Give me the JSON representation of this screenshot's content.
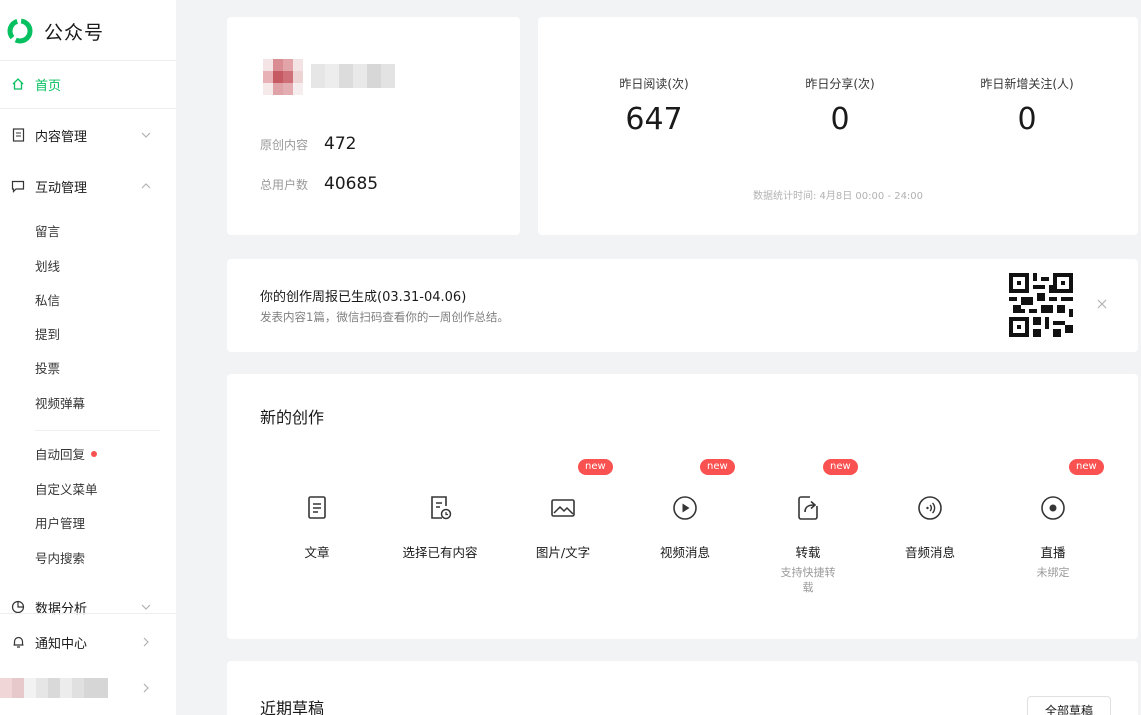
{
  "brand": {
    "name": "公众号",
    "accent": "#07c160"
  },
  "sidebar": {
    "home": "首页",
    "content_mgmt": "内容管理",
    "interaction_mgmt": "互动管理",
    "interaction_items": [
      "留言",
      "划线",
      "私信",
      "提到",
      "投票",
      "视频弹幕"
    ],
    "other_items": [
      "自动回复",
      "自定义菜单",
      "用户管理",
      "号内搜索"
    ],
    "data_analysis": "数据分析",
    "notifications": "通知中心"
  },
  "account": {
    "original_label": "原创内容",
    "original_value": "472",
    "users_label": "总用户数",
    "users_value": "40685"
  },
  "stats": {
    "reads_label": "昨日阅读(次)",
    "reads_value": "647",
    "shares_label": "昨日分享(次)",
    "shares_value": "0",
    "follows_label": "昨日新增关注(人)",
    "follows_value": "0",
    "note": "数据统计时间: 4月8日 00:00 - 24:00"
  },
  "report": {
    "title": "你的创作周报已生成(03.31-04.06)",
    "subtitle": "发表内容1篇，微信扫码查看你的一周创作总结。"
  },
  "create": {
    "title": "新的创作",
    "badge": "new",
    "items": [
      {
        "label": "文章",
        "icon": "article-icon"
      },
      {
        "label": "选择已有内容",
        "icon": "existing-content-icon"
      },
      {
        "label": "图片/文字",
        "icon": "image-text-icon"
      },
      {
        "label": "视频消息",
        "icon": "video-icon"
      },
      {
        "label": "转载",
        "sub": "支持快捷转载",
        "icon": "repost-icon"
      },
      {
        "label": "音频消息",
        "icon": "audio-icon"
      },
      {
        "label": "直播",
        "sub": "未绑定",
        "icon": "live-icon"
      }
    ]
  },
  "drafts": {
    "title": "近期草稿",
    "all_button": "全部草稿"
  }
}
